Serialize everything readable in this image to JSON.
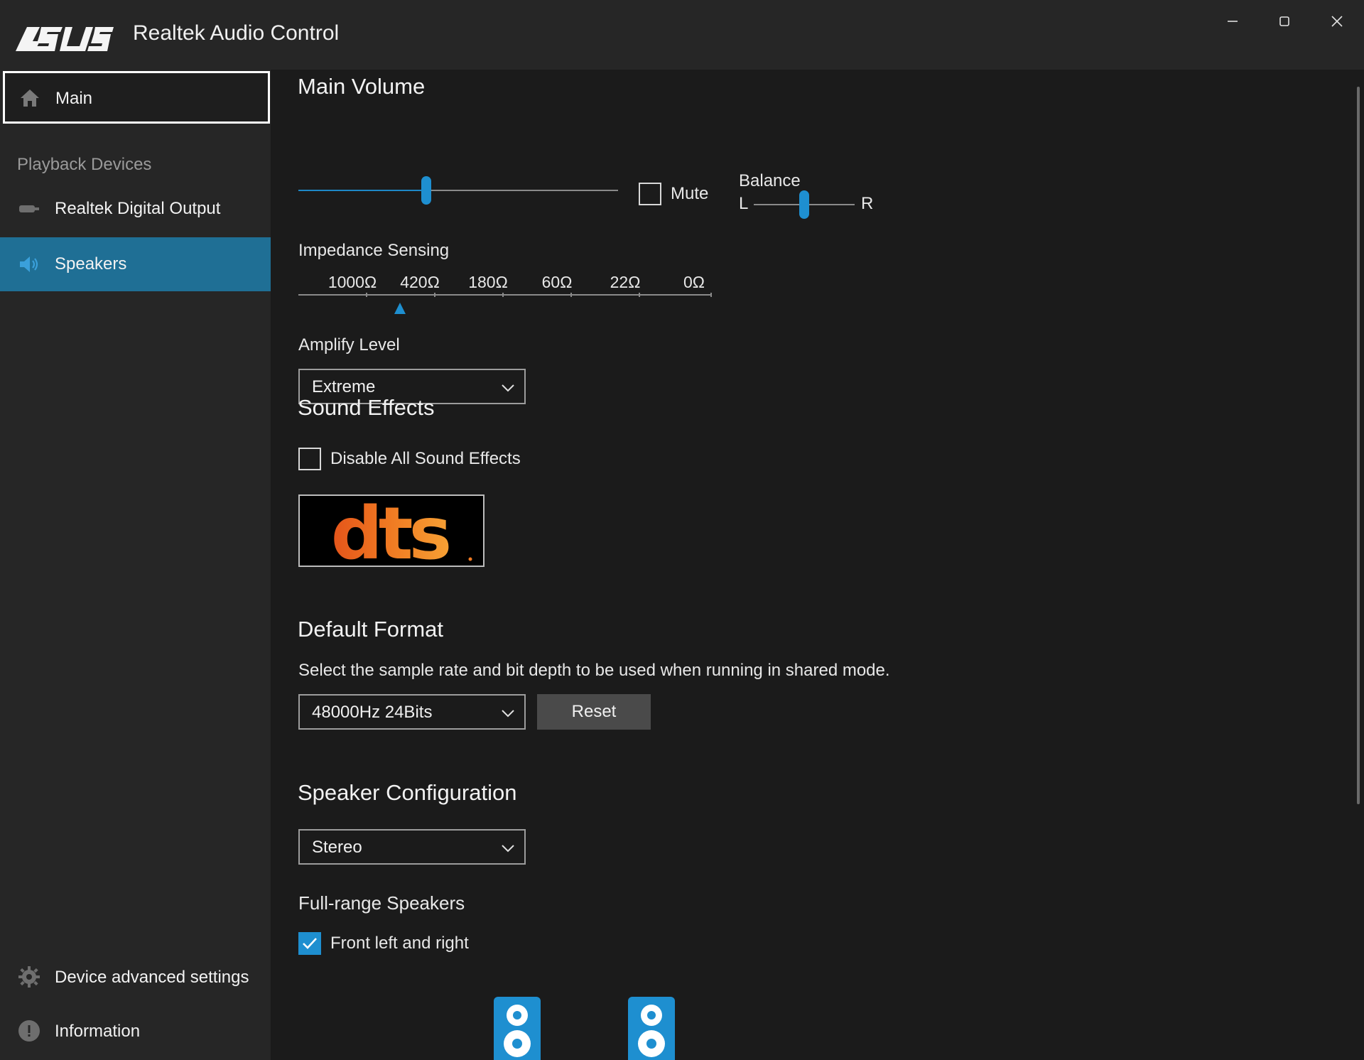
{
  "window": {
    "brand": "ASUS",
    "title": "Realtek Audio Control",
    "controls": {
      "minimize_icon": "minimize-icon",
      "maximize_icon": "maximize-icon",
      "close_icon": "close-icon"
    }
  },
  "sidebar": {
    "main_label": "Main",
    "section_caption": "Playback Devices",
    "devices": [
      {
        "label": "Realtek Digital Output",
        "icon": "digital-output-icon",
        "selected": false
      },
      {
        "label": "Speakers",
        "icon": "speaker-icon",
        "selected": true
      }
    ],
    "footer": [
      {
        "label": "Device advanced settings",
        "icon": "gear-icon"
      },
      {
        "label": "Information",
        "icon": "info-icon"
      }
    ]
  },
  "main_volume": {
    "title": "Main Volume",
    "volume_level": 0.4,
    "mute_label": "Mute",
    "mute_checked": false,
    "balance_label": "Balance",
    "balance_left": "L",
    "balance_right": "R",
    "balance_level": 0.5
  },
  "impedance": {
    "label": "Impedance Sensing",
    "ticks": [
      "1000Ω",
      "420Ω",
      "180Ω",
      "60Ω",
      "22Ω",
      "0Ω"
    ]
  },
  "amplify": {
    "label": "Amplify Level",
    "value": "Extreme"
  },
  "sound_effects": {
    "title": "Sound Effects",
    "disable_label": "Disable All Sound Effects",
    "disable_checked": false,
    "logo_text": "dts"
  },
  "default_format": {
    "title": "Default Format",
    "description": "Select the sample rate and bit depth to be used when running in shared mode.",
    "value": "48000Hz 24Bits",
    "reset_label": "Reset"
  },
  "speaker_config": {
    "title": "Speaker Configuration",
    "value": "Stereo",
    "fullrange_label": "Full-range Speakers",
    "front_lr_label": "Front left and right",
    "front_lr_checked": true
  },
  "colors": {
    "accent": "#1e8fd0",
    "selected_nav": "#1f6f95",
    "background": "#1b1b1b",
    "sidebar": "#262626"
  }
}
